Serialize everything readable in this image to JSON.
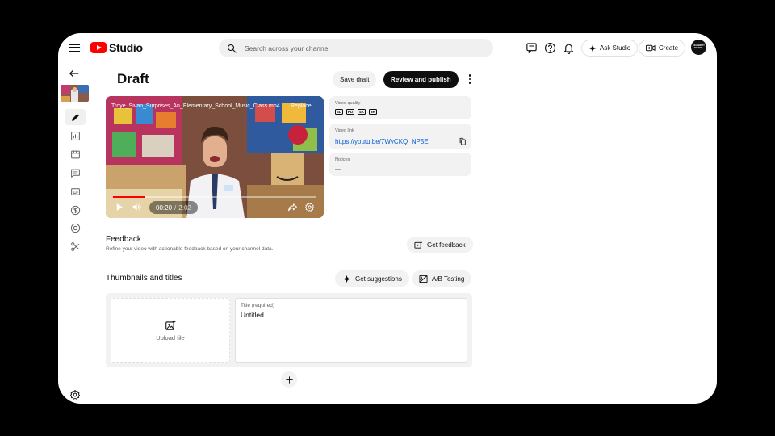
{
  "app": {
    "logo_text": "Studio"
  },
  "search": {
    "placeholder": "Search across your channel"
  },
  "top_actions": {
    "ask_studio": "Ask Studio",
    "create": "Create",
    "avatar_text": "CELEBRITY SCHOOL"
  },
  "page": {
    "title": "Draft",
    "save_draft": "Save draft",
    "review_publish": "Review and publish"
  },
  "video": {
    "filename": "Troye_Sivan_Surprises_An_Elementary_School_Music_Class.mp4",
    "replace_label": "Replace",
    "current_time": "00:20",
    "separator": "/",
    "duration": "2:02",
    "progress_fraction": 0.16
  },
  "info": {
    "quality_label": "Video quality",
    "quality_badges": [
      "SD",
      "HD",
      "4K",
      "8K"
    ],
    "link_label": "Video link",
    "link_value": "https://youtu.be/7WvCKQ_NP5E",
    "notices_label": "Notices",
    "notices_value": "—"
  },
  "feedback": {
    "title": "Feedback",
    "subtitle": "Refine your video with actionable feedback based on your channel data.",
    "button": "Get feedback"
  },
  "thumbnails": {
    "title": "Thumbnails and titles",
    "suggestions_button": "Get suggestions",
    "ab_button": "A/B Testing",
    "upload_label": "Upload file",
    "title_field_label": "Title (required)",
    "title_field_value": "Untitled"
  },
  "colors": {
    "brand_red": "#ff0000",
    "link_blue": "#065fd4",
    "accent_dark": "#0f0f0f"
  }
}
